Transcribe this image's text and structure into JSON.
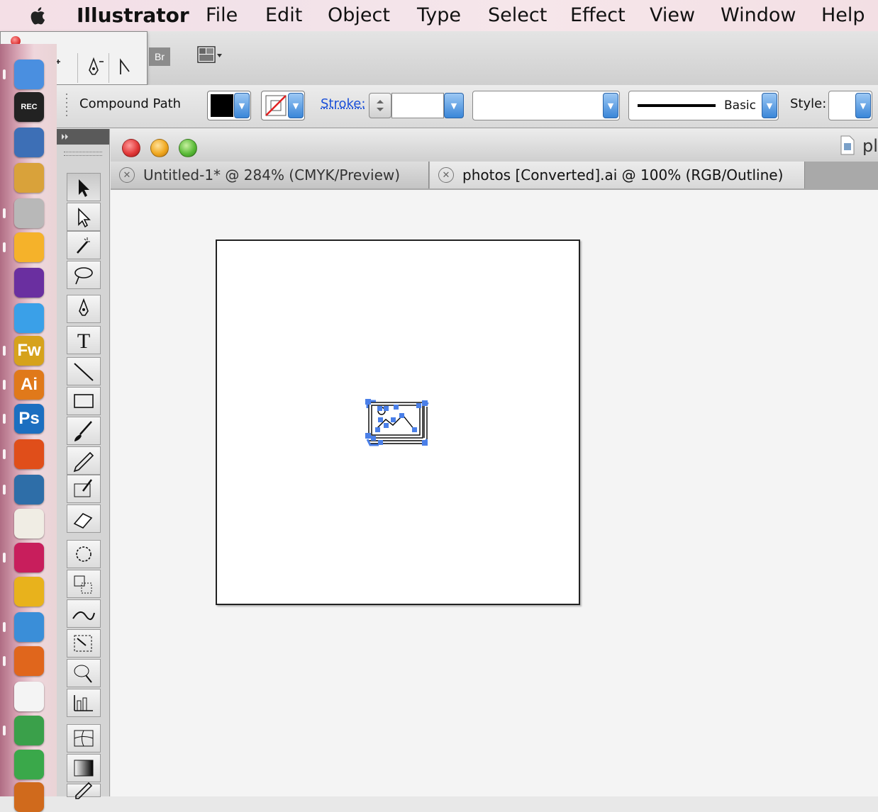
{
  "menubar": {
    "app_name": "Illustrator",
    "items": [
      "File",
      "Edit",
      "Object",
      "Type",
      "Select",
      "Effect",
      "View",
      "Window",
      "Help"
    ]
  },
  "appbar": {
    "bridge_label": "Br"
  },
  "dock": {
    "items": [
      {
        "name": "finder",
        "label": "",
        "color": "#4a8fe0"
      },
      {
        "name": "screen-recorder",
        "label": "REC",
        "color": "#222222"
      },
      {
        "name": "app-3",
        "label": "",
        "color": "#3d6fb6"
      },
      {
        "name": "app-4",
        "label": "",
        "color": "#d9a23a"
      },
      {
        "name": "app-5",
        "label": "",
        "color": "#b8b8b8"
      },
      {
        "name": "sketch",
        "label": "",
        "color": "#f5b22a"
      },
      {
        "name": "app-7",
        "label": "",
        "color": "#6a2fa0"
      },
      {
        "name": "app-8",
        "label": "",
        "color": "#3aa0e8"
      },
      {
        "name": "fireworks",
        "label": "Fw",
        "color": "#d6a21c"
      },
      {
        "name": "illustrator",
        "label": "Ai",
        "color": "#e0791a"
      },
      {
        "name": "photoshop",
        "label": "Ps",
        "color": "#1c6fc0"
      },
      {
        "name": "app-12",
        "label": "",
        "color": "#e04e1a"
      },
      {
        "name": "xcode",
        "label": "",
        "color": "#2e6ea8"
      },
      {
        "name": "textedit",
        "label": "",
        "color": "#f0ede4"
      },
      {
        "name": "app-15",
        "label": "",
        "color": "#c81e5c"
      },
      {
        "name": "opera",
        "label": "",
        "color": "#e8b21c"
      },
      {
        "name": "safari",
        "label": "",
        "color": "#3a8ed8"
      },
      {
        "name": "firefox",
        "label": "",
        "color": "#e0661c"
      },
      {
        "name": "launchpad",
        "label": "",
        "color": "#f4f4f4"
      },
      {
        "name": "chrome",
        "label": "",
        "color": "#3aa04a"
      },
      {
        "name": "evernote",
        "label": "",
        "color": "#3aa84a"
      },
      {
        "name": "app-22",
        "label": "",
        "color": "#d06a1c"
      }
    ]
  },
  "controlbar": {
    "selection_type": "Compound Path",
    "stroke_label": "Stroke:",
    "brush_label": "Basic",
    "style_label": "Style:"
  },
  "document": {
    "window_title_fragment": "pl",
    "tabs": [
      {
        "label": "Untitled-1* @ 284% (CMYK/Preview)",
        "active": false
      },
      {
        "label": "photos [Converted].ai @ 100% (RGB/Outline)",
        "active": true
      }
    ]
  },
  "tools": [
    "selection-tool",
    "direct-selection-tool",
    "magic-wand-tool",
    "lasso-tool",
    "pen-tool",
    "type-tool",
    "line-tool",
    "rectangle-tool",
    "paintbrush-tool",
    "pencil-tool",
    "blob-brush-tool",
    "eraser-tool",
    "rotate-tool",
    "scale-tool",
    "warp-tool",
    "free-transform-tool",
    "symbol-sprayer-tool",
    "graph-tool",
    "mesh-tool",
    "gradient-tool",
    "eyedropper-tool"
  ],
  "colors": {
    "selection_blue": "#4a7fe8",
    "fill_swatch": "#000000",
    "stroke_none": "#e02020"
  }
}
